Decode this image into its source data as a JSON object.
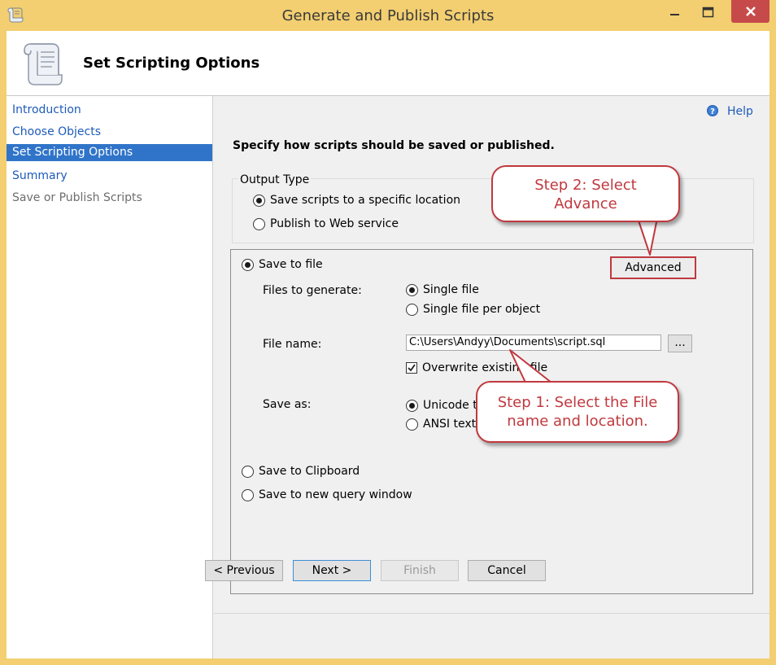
{
  "window": {
    "title": "Generate and Publish Scripts",
    "header_title": "Set Scripting Options"
  },
  "nav": {
    "items": [
      {
        "label": "Introduction",
        "state": "link"
      },
      {
        "label": "Choose Objects",
        "state": "link"
      },
      {
        "label": "Set Scripting Options",
        "state": "selected"
      },
      {
        "label": "Summary",
        "state": "link"
      },
      {
        "label": "Save or Publish Scripts",
        "state": "disabled"
      }
    ]
  },
  "main": {
    "help_label": "Help",
    "instruction": "Specify how scripts should be saved or published.",
    "output_type": {
      "legend": "Output Type",
      "options": [
        "Save scripts to a specific location",
        "Publish to Web service"
      ],
      "selected": 0
    },
    "save_to_file": {
      "label": "Save to file",
      "advanced_label": "Advanced",
      "files_to_generate_label": "Files to generate:",
      "files_options": [
        "Single file",
        "Single file per object"
      ],
      "file_name_label": "File name:",
      "file_name_value": "C:\\Users\\Andyy\\Documents\\script.sql",
      "browse_label": "...",
      "overwrite_label": "Overwrite existing file",
      "overwrite_checked": true,
      "save_as_label": "Save as:",
      "save_as_options": [
        "Unicode text",
        "ANSI text"
      ]
    },
    "save_to_clipboard_label": "Save to Clipboard",
    "save_to_query_window_label": "Save to new query window"
  },
  "footer": {
    "previous_label": "< Previous",
    "next_label": "Next >",
    "finish_label": "Finish",
    "cancel_label": "Cancel"
  },
  "annotations": {
    "step1": [
      "Step 1: Select the File",
      "name and location."
    ],
    "step2": [
      "Step 2: Select",
      "Advance"
    ],
    "accent_color": "#c0393f"
  },
  "colors": {
    "frame": "#f3cf71",
    "selection": "#2f74c9",
    "link": "#1e5bb8",
    "close_button": "#c74a4a"
  }
}
